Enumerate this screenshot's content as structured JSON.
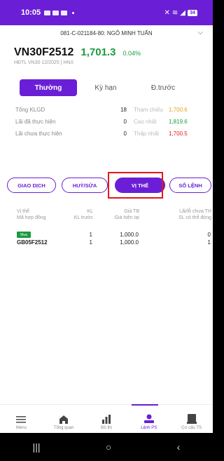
{
  "status_bar": {
    "time": "10:05",
    "battery": "34"
  },
  "account": {
    "label": "081-C-021184-80: NGÔ MINH TUẤN",
    "chevron": "⌵"
  },
  "instrument": {
    "symbol": "VN30F2512",
    "price": "1,701.3",
    "change_pct": "0.04%",
    "sub_info": "HĐTL VN30 12/2025 | HNX"
  },
  "order_tabs": [
    {
      "label": "Thường",
      "active": true
    },
    {
      "label": "Kỳ hạn",
      "active": false
    },
    {
      "label": "Đ.trước",
      "active": false
    }
  ],
  "stats": [
    {
      "label": "Tổng KLGD",
      "value": "18",
      "label2": "Tham chiếu",
      "value2": "1,700.6",
      "color2": "#e8a21a"
    },
    {
      "label": "Lãi đã thực hiện",
      "value": "0",
      "label2": "Cao nhất",
      "value2": "1,819.6",
      "color2": "#1a9b3d"
    },
    {
      "label": "Lãi chưa thực hiện",
      "value": "0",
      "label2": "Thấp nhất",
      "value2": "1,700.5",
      "color2": "#e4161b"
    }
  ],
  "actions": [
    {
      "label": "GIAO DỊCH",
      "active": false
    },
    {
      "label": "HUỶ/SỬA",
      "active": false
    },
    {
      "label": "VỊ THẾ",
      "active": true
    },
    {
      "label": "SỔ LỆNH",
      "active": false
    }
  ],
  "table": {
    "headers": {
      "c1a": "Vị thế",
      "c1b": "Mã hợp đồng",
      "c2a": "KL",
      "c2b": "KL trước",
      "c3a": "Giá TB",
      "c3b": "Giá hiện tại",
      "c4a": "Lãi/lỗ chưa TH",
      "c4b": "SL có thể đóng"
    },
    "rows": [
      {
        "tag": "Mua",
        "contract": "GB05F2512",
        "kl": "1",
        "kl_prev": "1",
        "avg_price": "1,000.0",
        "cur_price": "1,000.0",
        "pnl": "0",
        "closable": "1"
      }
    ]
  },
  "bottom_nav": [
    {
      "label": "Menu",
      "icon": "menu-icon",
      "active": false
    },
    {
      "label": "Tổng quan",
      "icon": "home-icon",
      "active": false
    },
    {
      "label": "Đồ thị",
      "icon": "chart-icon",
      "active": false
    },
    {
      "label": "Lệnh PS",
      "icon": "derivative-order-icon",
      "active": true
    },
    {
      "label": "Cơ cấu TS",
      "icon": "portfolio-icon",
      "active": false
    }
  ],
  "system_nav": {
    "recent": "|||",
    "home": "○",
    "back": "‹"
  },
  "colors": {
    "accent": "#6a1fd6",
    "up": "#1a9b3d",
    "down": "#e4161b",
    "ref": "#e8a21a",
    "highlight": "#e4161b"
  }
}
